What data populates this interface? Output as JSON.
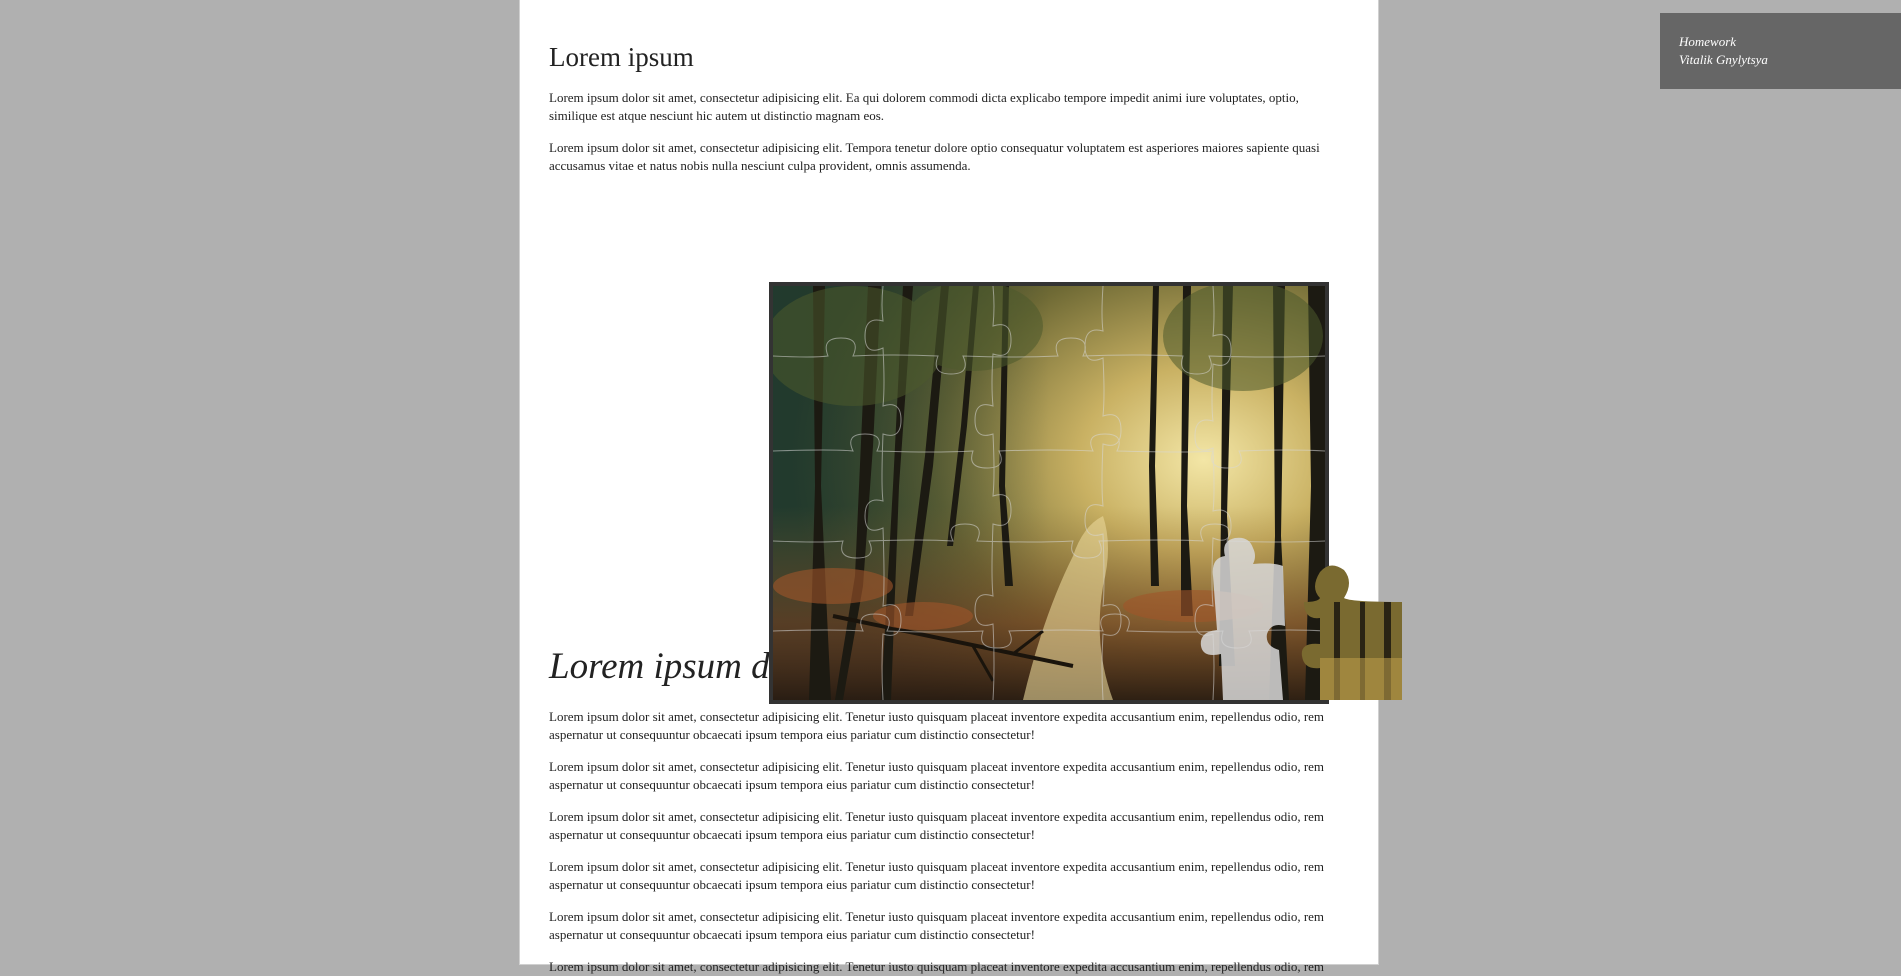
{
  "article": {
    "title": "Lorem ipsum",
    "intro_paragraphs": [
      "Lorem ipsum dolor sit amet, consectetur adipisicing elit. Ea qui dolorem commodi dicta explicabo tempore impedit animi iure voluptates, optio, similique est atque nesciunt hic autem ut distinctio magnam eos.",
      "Lorem ipsum dolor sit amet, consectetur adipisicing elit. Tempora tenetur dolore optio consequatur voluptatem est asperiores maiores sapiente quasi accusamus vitae et natus nobis nulla nesciunt culpa provident, omnis assumenda."
    ],
    "subtitle": "Lorem ipsum do",
    "body_paragraphs": [
      "Lorem ipsum dolor sit amet, consectetur adipisicing elit. Tenetur iusto quisquam placeat inventore expedita accusantium enim, repellendus odio, rem aspernatur ut consequuntur obcaecati ipsum tempora eius pariatur cum distinctio consectetur!",
      "Lorem ipsum dolor sit amet, consectetur adipisicing elit. Tenetur iusto quisquam placeat inventore expedita accusantium enim, repellendus odio, rem aspernatur ut consequuntur obcaecati ipsum tempora eius pariatur cum distinctio consectetur!",
      "Lorem ipsum dolor sit amet, consectetur adipisicing elit. Tenetur iusto quisquam placeat inventore expedita accusantium enim, repellendus odio, rem aspernatur ut consequuntur obcaecati ipsum tempora eius pariatur cum distinctio consectetur!",
      "Lorem ipsum dolor sit amet, consectetur adipisicing elit. Tenetur iusto quisquam placeat inventore expedita accusantium enim, repellendus odio, rem aspernatur ut consequuntur obcaecati ipsum tempora eius pariatur cum distinctio consectetur!",
      "Lorem ipsum dolor sit amet, consectetur adipisicing elit. Tenetur iusto quisquam placeat inventore expedita accusantium enim, repellendus odio, rem aspernatur ut consequuntur obcaecati ipsum tempora eius pariatur cum distinctio consectetur!",
      "Lorem ipsum dolor sit amet, consectetur adipisicing elit. Tenetur iusto quisquam placeat inventore expedita accusantium enim, repellendus odio, rem"
    ]
  },
  "homework_badge": {
    "line1": "Homework",
    "line2": "Vitalik Gnylytsya"
  },
  "puzzle": {
    "image_subject": "forest-path-sunlight",
    "colors": {
      "frame": "#333333",
      "light": "#e8d58a",
      "mid": "#8a7a3a",
      "dark": "#2b2a1a",
      "leaf_green": "#5a6b3a",
      "autumn": "#a0552a"
    }
  }
}
